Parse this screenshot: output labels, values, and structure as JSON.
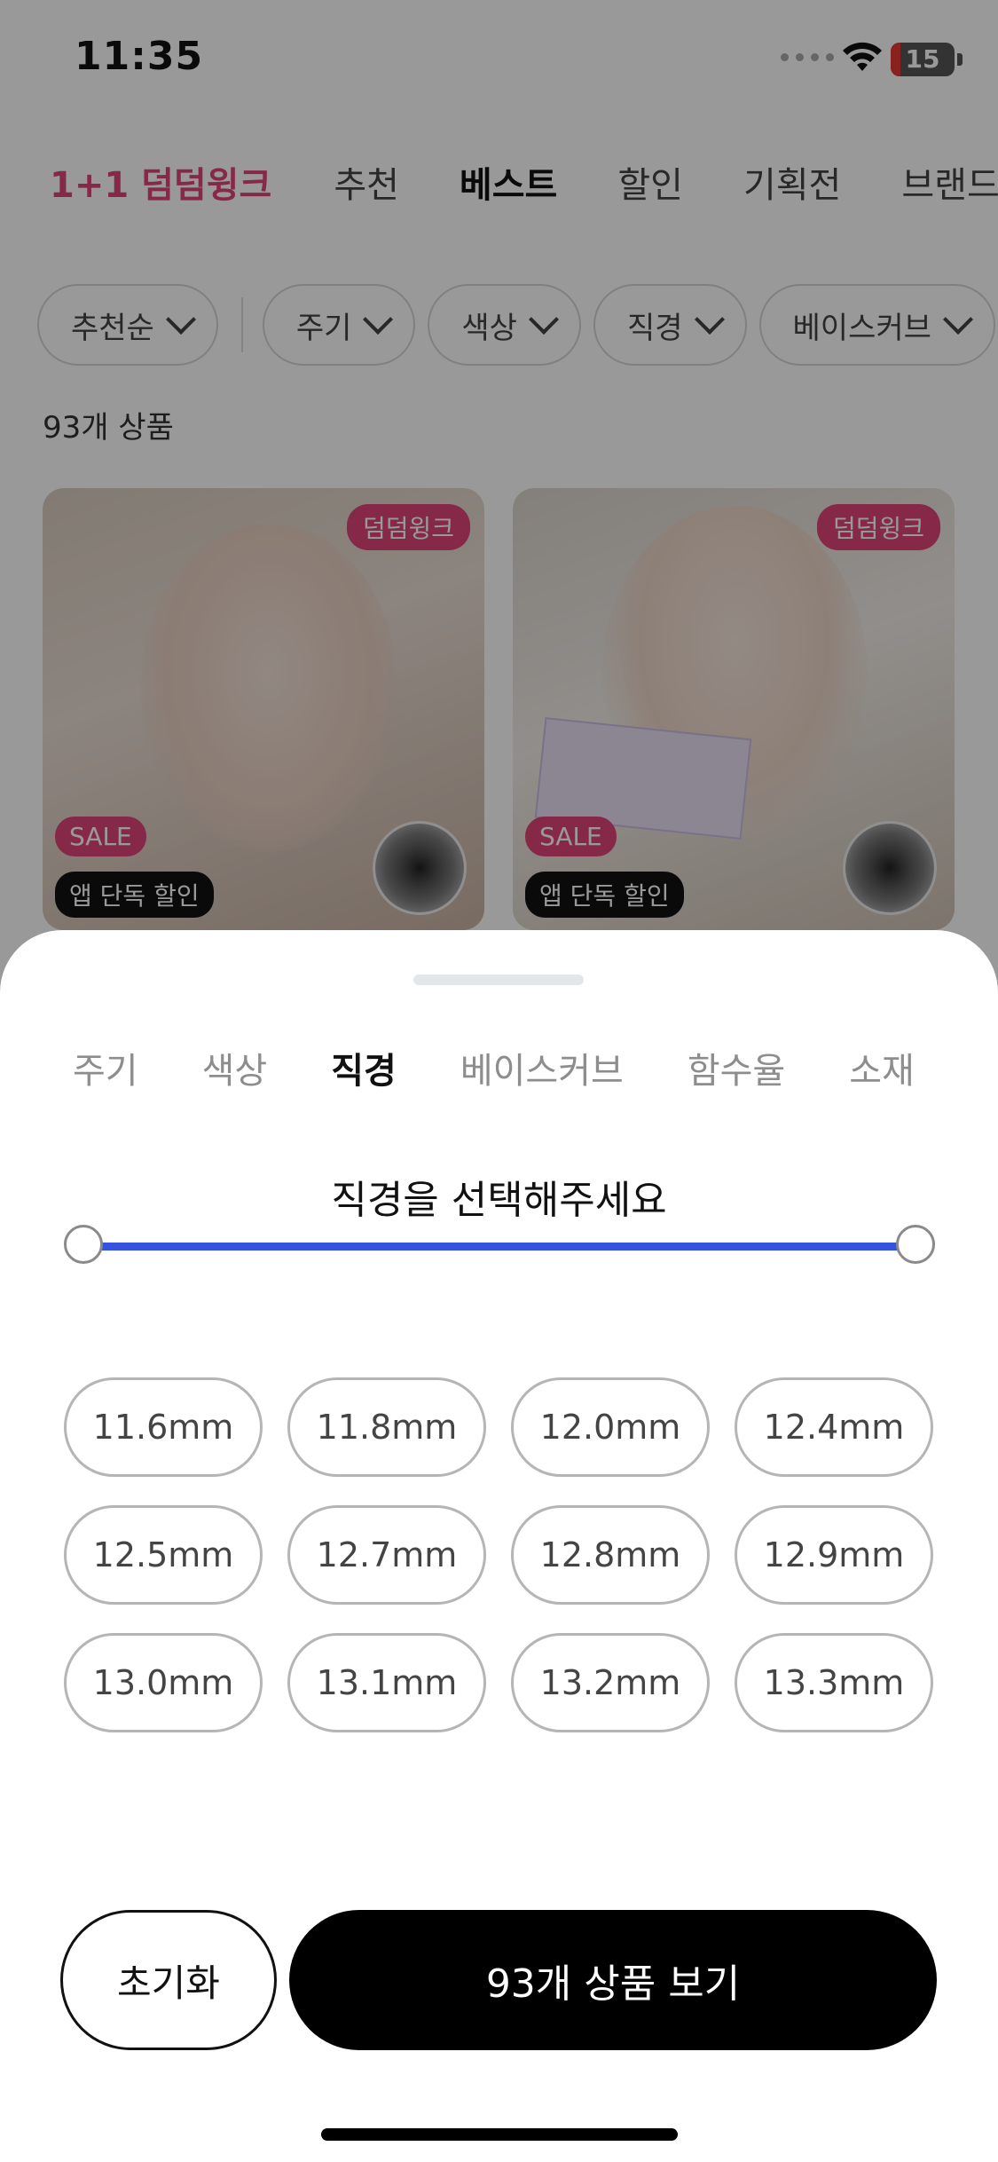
{
  "status_bar": {
    "time": "11:35",
    "battery": "15",
    "battery_level_percent": 15,
    "icons": [
      "signal-icon",
      "wifi-icon",
      "battery-icon"
    ]
  },
  "top_nav": {
    "items": [
      {
        "label": "1+1 덤덤윙크",
        "active": false,
        "accent": true
      },
      {
        "label": "추천",
        "active": false
      },
      {
        "label": "베스트",
        "active": true
      },
      {
        "label": "할인",
        "active": false
      },
      {
        "label": "기획전",
        "active": false
      },
      {
        "label": "브랜드",
        "active": false
      }
    ]
  },
  "filters": {
    "sort": "추천순",
    "items": [
      "주기",
      "색상",
      "직경",
      "베이스커브"
    ]
  },
  "product_count": "93개 상품",
  "products": [
    {
      "brand_tag": "덤덤윙크",
      "sale_tag": "SALE",
      "app_tag": "앱 단독 할인"
    },
    {
      "brand_tag": "덤덤윙크",
      "sale_tag": "SALE",
      "app_tag": "앱 단독 할인"
    }
  ],
  "sheet": {
    "tabs": [
      {
        "label": "주기",
        "active": false
      },
      {
        "label": "색상",
        "active": false
      },
      {
        "label": "직경",
        "active": true
      },
      {
        "label": "베이스커브",
        "active": false
      },
      {
        "label": "함수율",
        "active": false
      },
      {
        "label": "소재",
        "active": false
      }
    ],
    "title": "직경을 선택해주세요",
    "slider": {
      "min_fraction": 0,
      "max_fraction": 1
    },
    "options": [
      "11.6mm",
      "11.8mm",
      "12.0mm",
      "12.4mm",
      "12.5mm",
      "12.7mm",
      "12.8mm",
      "12.9mm",
      "13.0mm",
      "13.1mm",
      "13.2mm",
      "13.3mm"
    ],
    "reset_label": "초기화",
    "view_label": "93개 상품 보기"
  },
  "colors": {
    "accent_pink": "#e0457b",
    "slider_blue": "#3552e0",
    "primary_button": "#000000"
  }
}
